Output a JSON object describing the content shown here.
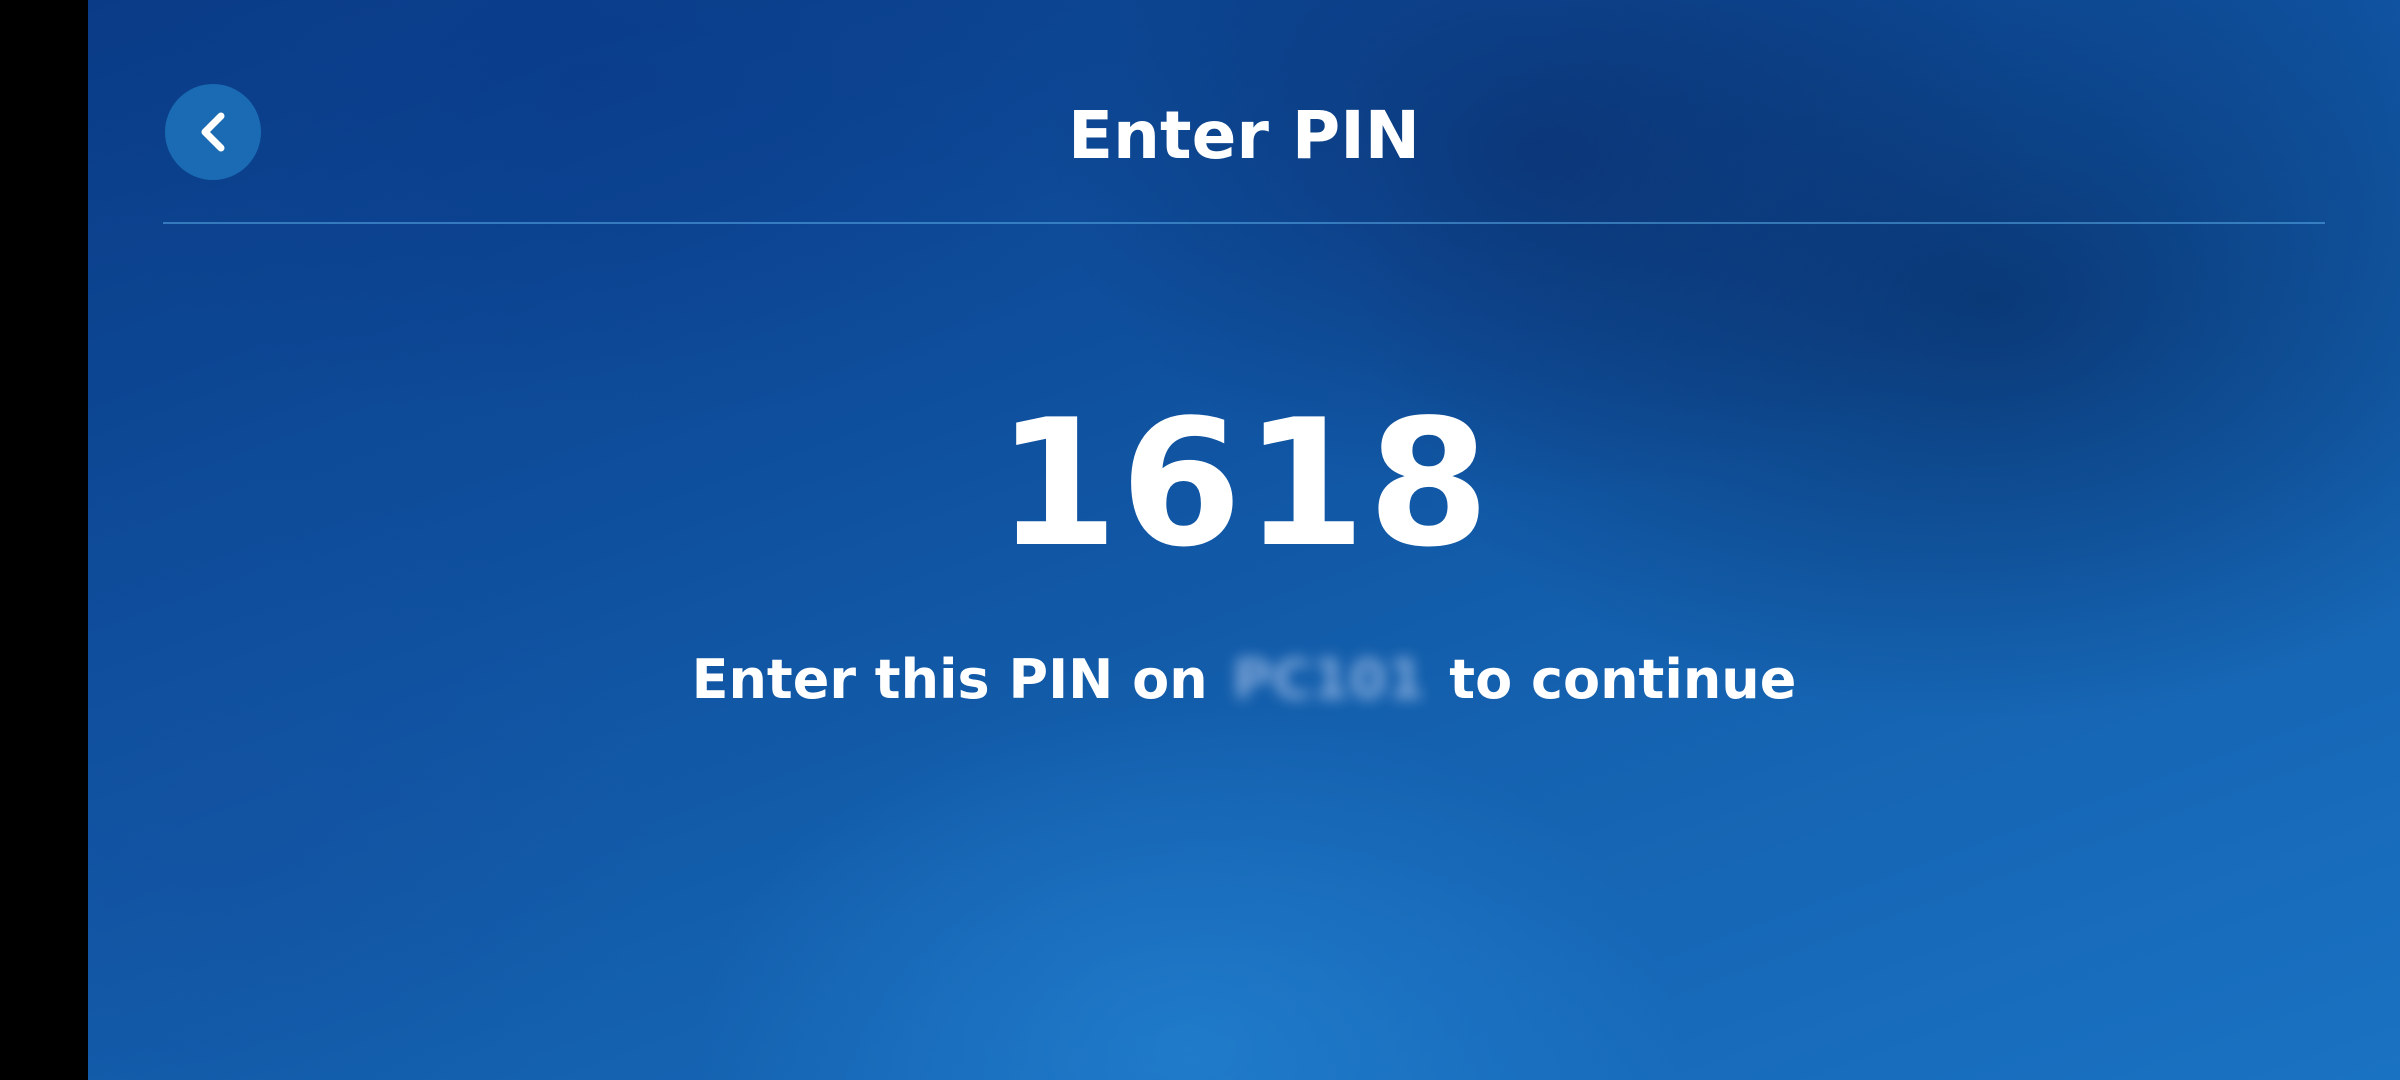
{
  "header": {
    "title": "Enter PIN",
    "back_icon": "chevron-left-icon"
  },
  "pin": {
    "code": "1618"
  },
  "instruction": {
    "prefix": "Enter this PIN on",
    "device_name": "PC101",
    "suffix": "to continue"
  },
  "colors": {
    "background": "#0e4e9c",
    "back_button": "#1a6bb3",
    "text": "#ffffff"
  }
}
